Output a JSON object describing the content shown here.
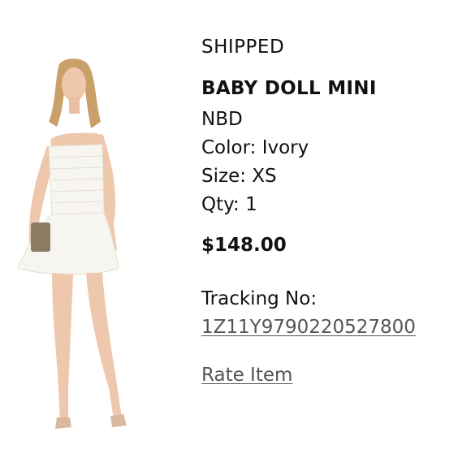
{
  "order_item": {
    "status": "SHIPPED",
    "product_name": "BABY DOLL MINI",
    "brand": "NBD",
    "color": "Color: Ivory",
    "size": "Size: XS",
    "qty": "Qty: 1",
    "price": "$148.00",
    "tracking_label": "Tracking No:",
    "tracking_number": "1Z11Y9790220527800",
    "rate_label": "Rate Item"
  },
  "colors": {
    "text": "#111111",
    "link": "#555555",
    "dress": "#f7f5ef",
    "skin": "#efc7ad",
    "hair": "#c9a06a",
    "clutch": "#8b7b62"
  },
  "image": {
    "description_icon": "product-photo"
  }
}
